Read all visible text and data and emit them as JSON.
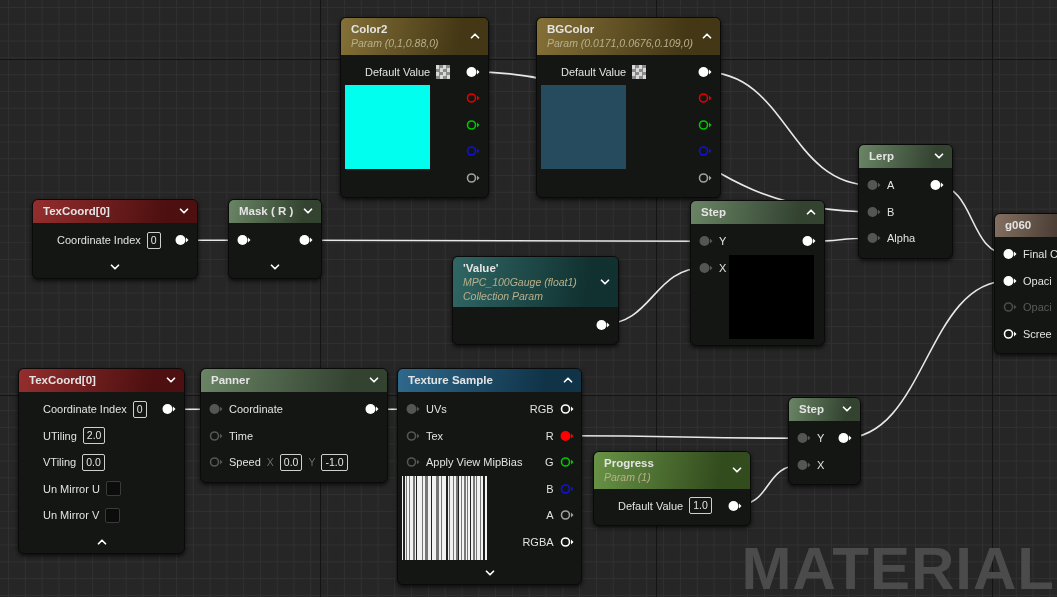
{
  "nodes": [
    {
      "title": "Color2",
      "subtitle": "Param (0,1,0.88,0)",
      "color": "#7a6426",
      "expanded": true,
      "inputs": [
        {
          "kind": "color-property",
          "label": "Default Value"
        },
        {
          "kind": "preview",
          "color": "#00ffee"
        }
      ],
      "outputs": [
        {
          "kind": "pin",
          "connected": true,
          "color": "#ffffff"
        },
        {
          "kind": "pin",
          "connected": false,
          "color": "#e00000"
        },
        {
          "kind": "pin",
          "connected": false,
          "color": "#00c800"
        },
        {
          "kind": "pin",
          "connected": false,
          "color": "#1010e0"
        },
        {
          "kind": "pin",
          "connected": false,
          "color": "#a0a0a0"
        }
      ]
    },
    {
      "title": "BGColor",
      "subtitle": "Param (0.0171,0.0676,0.109,0)",
      "color": "#7a6426",
      "expanded": true,
      "inputs": [
        {
          "kind": "color-property",
          "label": "Default Value"
        },
        {
          "kind": "preview",
          "color": "#264b5e"
        }
      ],
      "outputs": [
        {
          "kind": "pin",
          "connected": true,
          "color": "#ffffff"
        },
        {
          "kind": "pin",
          "connected": false,
          "color": "#e00000"
        },
        {
          "kind": "pin",
          "connected": false,
          "color": "#00c800"
        },
        {
          "kind": "pin",
          "connected": false,
          "color": "#1010e0"
        },
        {
          "kind": "pin",
          "connected": false,
          "color": "#a0a0a0"
        }
      ]
    },
    {
      "title": "TexCoord[0]",
      "color": "#8c1c1c",
      "expanded": false,
      "advanced_shown": false,
      "inputs": [
        {
          "kind": "property",
          "label": "Coordinate Index",
          "value": "0"
        }
      ],
      "outputs": [
        {
          "kind": "pin",
          "connected": true
        }
      ]
    },
    {
      "title": "Mask ( R )",
      "color": "#5d7a58",
      "expanded": false,
      "advanced_shown": false,
      "inputs": [
        {
          "kind": "pin",
          "connected": true,
          "color": "#ffffff"
        }
      ],
      "outputs": [
        {
          "kind": "pin",
          "connected": true
        }
      ]
    },
    {
      "title": "'Value'",
      "subtitle": "MPC_100Gauge (float1) Collection Param",
      "color": "#1e5a58",
      "expanded": false,
      "outputs": [
        {
          "kind": "pin",
          "connected": true
        }
      ]
    },
    {
      "title": "Step",
      "color": "#5d7a58",
      "expanded": true,
      "inputs": [
        {
          "kind": "pin",
          "label": "Y",
          "connected": true
        },
        {
          "kind": "pin",
          "label": "X",
          "connected": true
        }
      ],
      "outputs": [
        {
          "kind": "pin",
          "connected": true
        },
        {
          "kind": "preview",
          "color": "#000000"
        }
      ]
    },
    {
      "title": "Lerp",
      "color": "#5d7a58",
      "expanded": false,
      "inputs": [
        {
          "kind": "pin",
          "label": "A",
          "connected": true
        },
        {
          "kind": "pin",
          "label": "B",
          "connected": true
        },
        {
          "kind": "pin",
          "label": "Alpha",
          "connected": true
        }
      ],
      "outputs": [
        {
          "kind": "pin",
          "connected": true
        }
      ]
    },
    {
      "title": "g060",
      "color": "#7a6455",
      "inputs": [
        {
          "kind": "pin",
          "label": "Final C",
          "connected": true,
          "color": "#ffffff",
          "disabled": false
        },
        {
          "kind": "pin",
          "label": "Opaci",
          "connected": true,
          "color": "#ffffff",
          "disabled": false
        },
        {
          "kind": "pin",
          "label": "Opaci",
          "connected": false,
          "color": "#4a4a4a",
          "disabled": true
        },
        {
          "kind": "pin",
          "label": "Scree",
          "connected": false,
          "color": "#ffffff",
          "disabled": false
        }
      ]
    },
    {
      "title": "TexCoord[0]",
      "color": "#8c1c1c",
      "expanded": false,
      "advanced_shown": true,
      "inputs": [
        {
          "kind": "property",
          "label": "Coordinate Index",
          "value": "0"
        },
        {
          "kind": "property",
          "label": "UTiling",
          "value": "2.0"
        },
        {
          "kind": "property",
          "label": "VTiling",
          "value": "0.0"
        },
        {
          "kind": "checkbox",
          "label": "Un Mirror U",
          "checked": false
        },
        {
          "kind": "checkbox",
          "label": "Un Mirror V",
          "checked": false
        }
      ],
      "outputs": [
        {
          "kind": "pin",
          "connected": true
        }
      ]
    },
    {
      "title": "Panner",
      "color": "#5d7a58",
      "expanded": false,
      "inputs": [
        {
          "kind": "pin",
          "label": "Coordinate",
          "connected": true
        },
        {
          "kind": "pin",
          "label": "Time",
          "connected": false
        },
        {
          "kind": "pin",
          "label": "Speed",
          "connected": false,
          "fields": [
            {
              "axis": "X",
              "value": "0.0"
            },
            {
              "axis": "Y",
              "value": "-1.0"
            }
          ]
        }
      ],
      "outputs": [
        {
          "kind": "pin",
          "connected": true
        }
      ]
    },
    {
      "title": "Texture Sample",
      "color": "#1d5c82",
      "expanded": true,
      "advanced_shown": false,
      "inputs": [
        {
          "kind": "pin",
          "label": "UVs",
          "connected": true
        },
        {
          "kind": "pin",
          "label": "Tex",
          "connected": false
        },
        {
          "kind": "pin",
          "label": "Apply View MipBias",
          "connected": false
        },
        {
          "kind": "texture-preview"
        }
      ],
      "outputs": [
        {
          "kind": "pin",
          "label": "RGB",
          "connected": false,
          "color": "#ffffff"
        },
        {
          "kind": "pin",
          "label": "R",
          "connected": true,
          "color": "#ff0000"
        },
        {
          "kind": "pin",
          "label": "G",
          "connected": false,
          "color": "#00c800"
        },
        {
          "kind": "pin",
          "label": "B",
          "connected": false,
          "color": "#1010e0"
        },
        {
          "kind": "pin",
          "label": "A",
          "connected": false,
          "color": "#a0a0a0"
        },
        {
          "kind": "pin",
          "label": "RGBA",
          "connected": false,
          "color": "#ffffff"
        }
      ]
    },
    {
      "title": "Progress",
      "subtitle": "Param (1)",
      "color": "#5c8a36",
      "expanded": false,
      "inputs": [
        {
          "kind": "property",
          "label": "Default Value",
          "value": "1.0"
        }
      ],
      "outputs": [
        {
          "kind": "pin",
          "connected": true
        }
      ]
    },
    {
      "title": "Step",
      "color": "#5d7a58",
      "expanded": false,
      "inputs": [
        {
          "kind": "pin",
          "label": "Y",
          "connected": true
        },
        {
          "kind": "pin",
          "label": "X",
          "connected": true
        }
      ],
      "outputs": [
        {
          "kind": "pin",
          "connected": true
        }
      ]
    }
  ],
  "graph_label": "MATERIAL"
}
